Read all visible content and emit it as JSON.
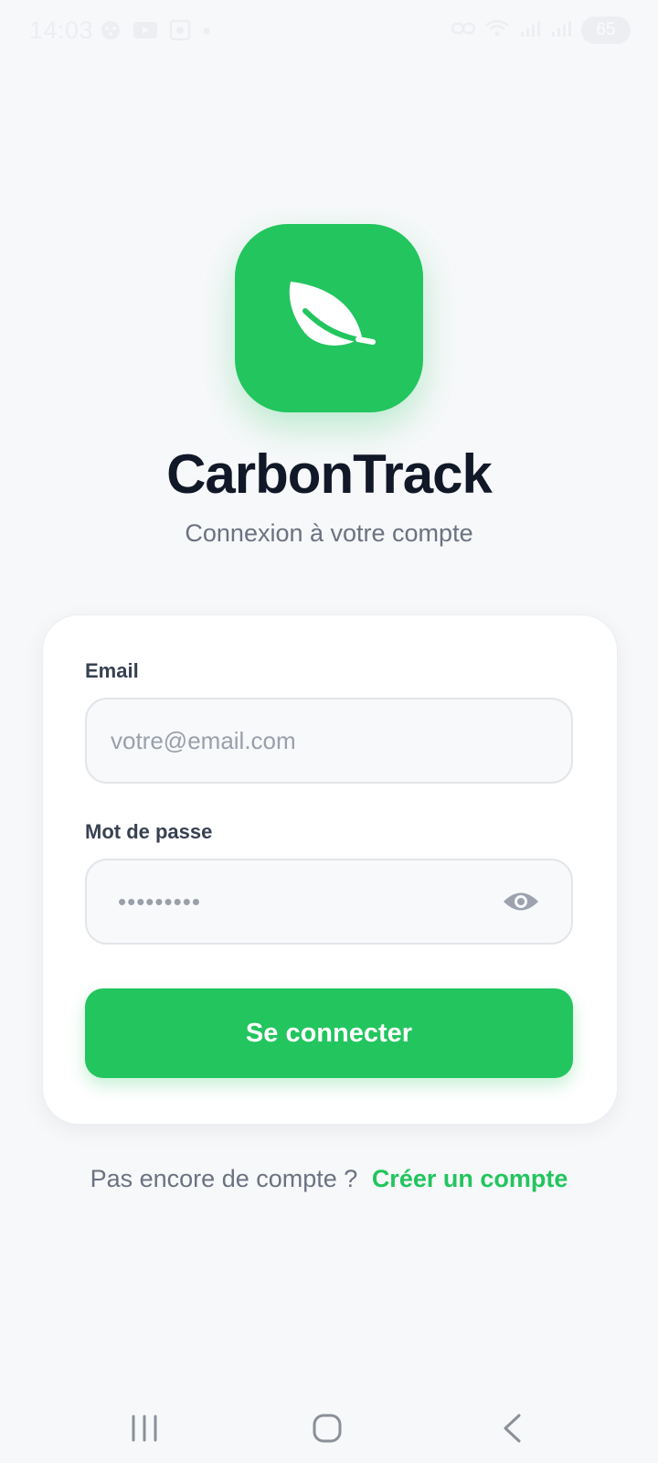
{
  "status_bar": {
    "time": "14:03",
    "battery": "65"
  },
  "app": {
    "icon": "leaf-icon",
    "name": "CarbonTrack",
    "subtitle": "Connexion à votre compte"
  },
  "login_form": {
    "email_label": "Email",
    "email_placeholder": "votre@email.com",
    "password_label": "Mot de passe",
    "password_placeholder": "•••••••••",
    "password_toggle_icon": "eye-icon",
    "submit_label": "Se connecter"
  },
  "signup": {
    "prompt": "Pas encore de compte ?",
    "link": "Créer un compte"
  },
  "nav_bar": {
    "icons": [
      "recent-apps-icon",
      "home-icon",
      "back-icon"
    ]
  },
  "colors": {
    "accent": "#22c55e",
    "background": "#f7f8fa",
    "card": "#ffffff",
    "title": "#111827",
    "muted": "#6b7280"
  }
}
